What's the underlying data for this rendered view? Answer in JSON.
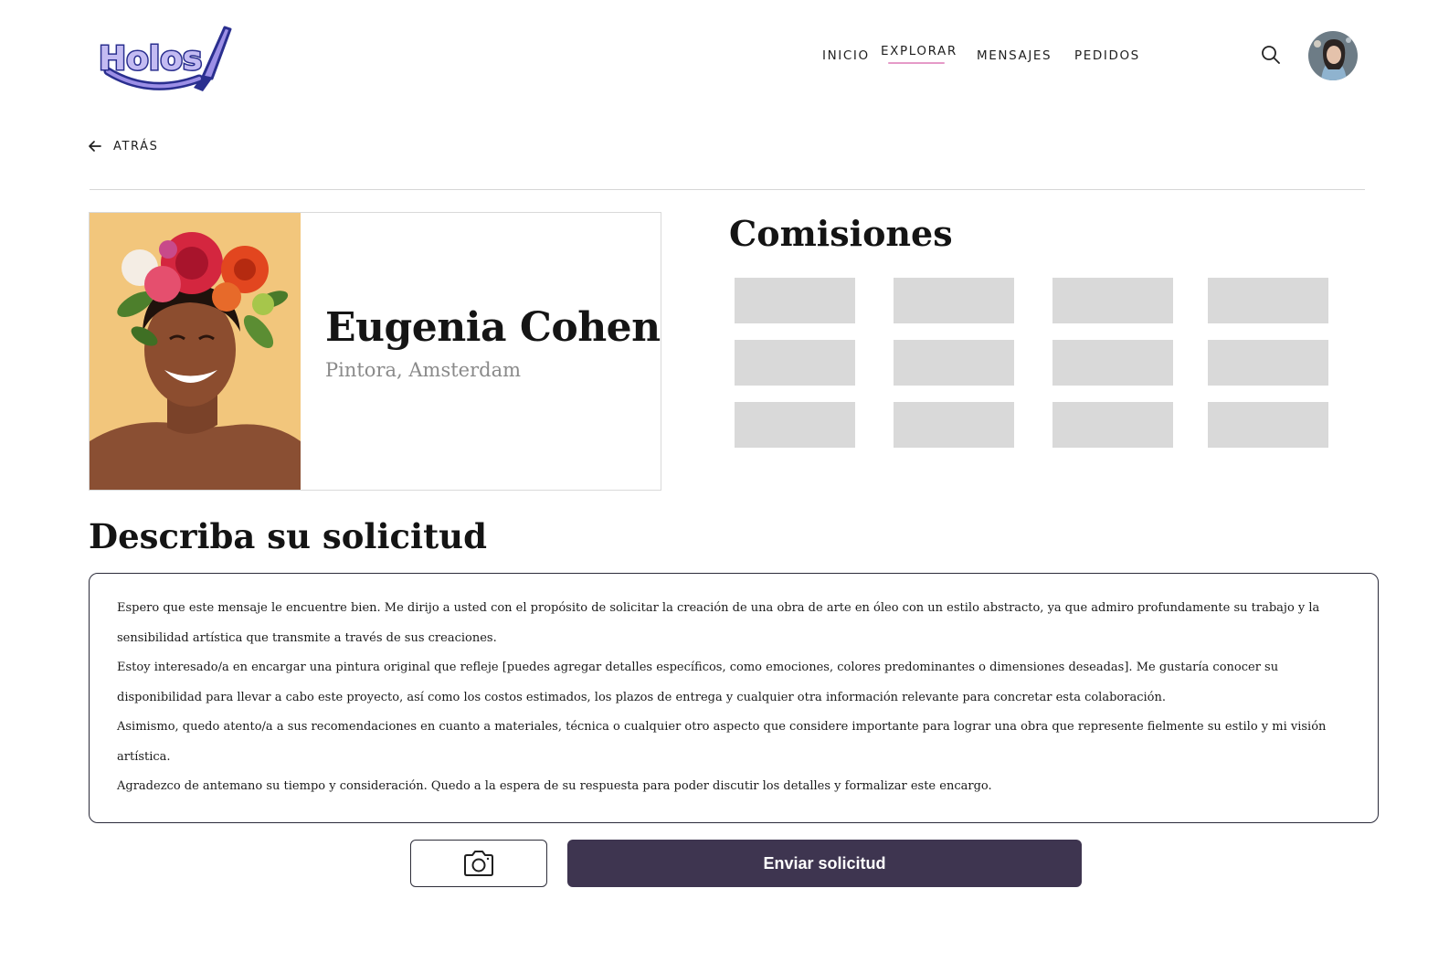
{
  "header": {
    "logo_text": "Holos",
    "nav": [
      {
        "label": "INICIO",
        "active": false
      },
      {
        "label": "EXPLORAR",
        "active": true
      },
      {
        "label": "MENSAJES",
        "active": false
      },
      {
        "label": "PEDIDOS",
        "active": false
      }
    ],
    "search_icon": "search-icon",
    "accent_color": "#e59ac8"
  },
  "back": {
    "label": "ATRÁS",
    "icon": "arrow-left-icon"
  },
  "profile": {
    "name": "Eugenia Cohen",
    "subtitle": "Pintora, Amsterdam"
  },
  "commissions": {
    "title": "Comisiones",
    "tile_count": 12
  },
  "request": {
    "title": "Describa su solicitud",
    "paragraphs": [
      "Espero que este mensaje le encuentre bien. Me dirijo a usted con el propósito de solicitar la creación de una obra de arte en óleo con un estilo abstracto, ya que admiro profundamente su trabajo y la sensibilidad artística que transmite a través de sus creaciones.",
      "Estoy interesado/a en encargar una pintura original que refleje [puedes agregar detalles específicos, como emociones, colores predominantes o dimensiones deseadas]. Me gustaría conocer su disponibilidad para llevar a cabo este proyecto, así como los costos estimados, los plazos de entrega y cualquier otra información relevante para concretar esta colaboración.",
      "Asimismo, quedo atento/a a sus recomendaciones en cuanto a materiales, técnica o cualquier otro aspecto que considere importante para lograr una obra que represente fielmente su estilo y mi visión artística.",
      "Agradezco de antemano su tiempo y consideración. Quedo a la espera de su respuesta para poder discutir los detalles y formalizar este encargo."
    ]
  },
  "actions": {
    "photo_icon": "camera-icon",
    "send_label": "Enviar solicitud",
    "send_color": "#3e3550"
  }
}
